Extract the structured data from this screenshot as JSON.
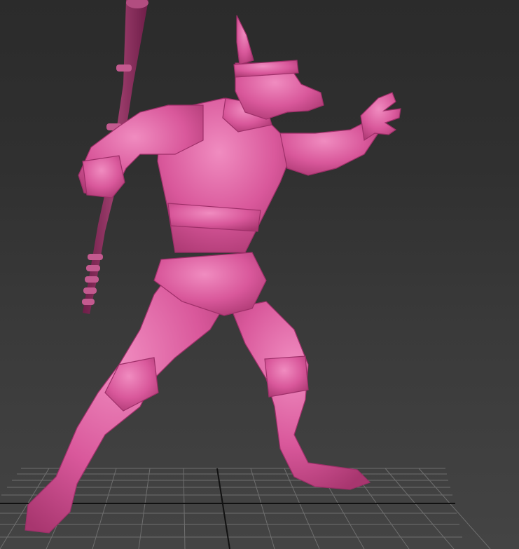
{
  "viewport": {
    "background_top": "#2b2b2b",
    "background_bottom": "#444444"
  },
  "scene": {
    "model_color": "#d9589b",
    "model_highlight": "#f08cc0",
    "model_shadow": "#9e2f69",
    "staff_color": "#8a2a5c",
    "grid_color": "#7a7a7a",
    "grid_axis_color": "#111111"
  }
}
